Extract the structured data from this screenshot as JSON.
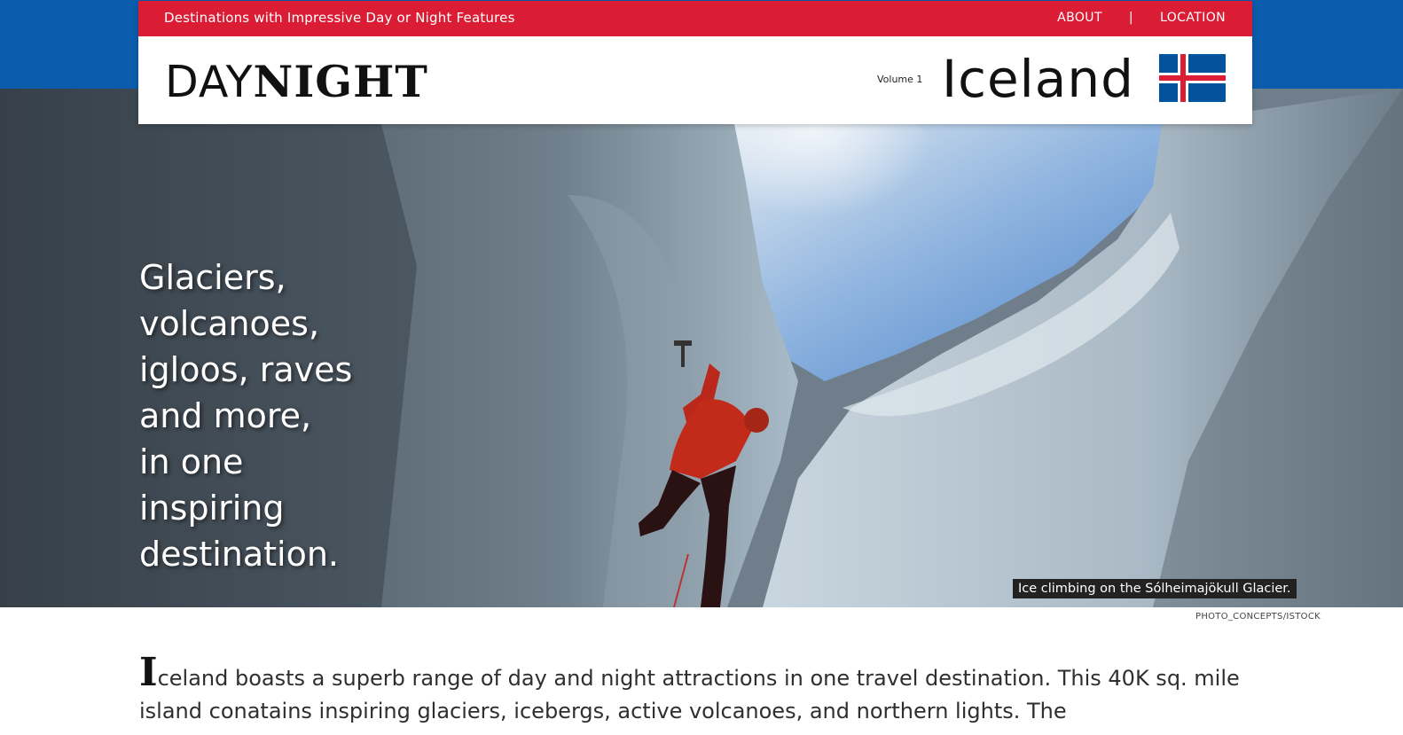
{
  "header": {
    "tagline": "Destinations with Impressive Day or Night Features",
    "nav": {
      "about": "ABOUT",
      "separator": "|",
      "location": "LOCATION"
    },
    "logo": {
      "light": "DAY",
      "bold": "NIGHT"
    },
    "volume": "Volume 1",
    "country": "Iceland",
    "flag": "iceland-flag"
  },
  "hero": {
    "headline": [
      "Glaciers,",
      "volcanoes,",
      "igloos, raves",
      "and more,",
      "in one",
      "inspiring",
      "destination."
    ],
    "caption": "Ice climbing on the Sólheimajökull Glacier.",
    "credit": "PHOTO_CONCEPTS/ISTOCK"
  },
  "intro": {
    "dropcap": "I",
    "text": "celand boasts a superb range of day and night attractions in one travel destination. This 40K sq. mile island conatains inspiring glaciers, icebergs, active volcanoes, and northern lights. The"
  },
  "colors": {
    "red": "#da1d35",
    "blue": "#0b5cad",
    "flag_blue": "#02529c",
    "flag_red": "#dc1e35"
  }
}
